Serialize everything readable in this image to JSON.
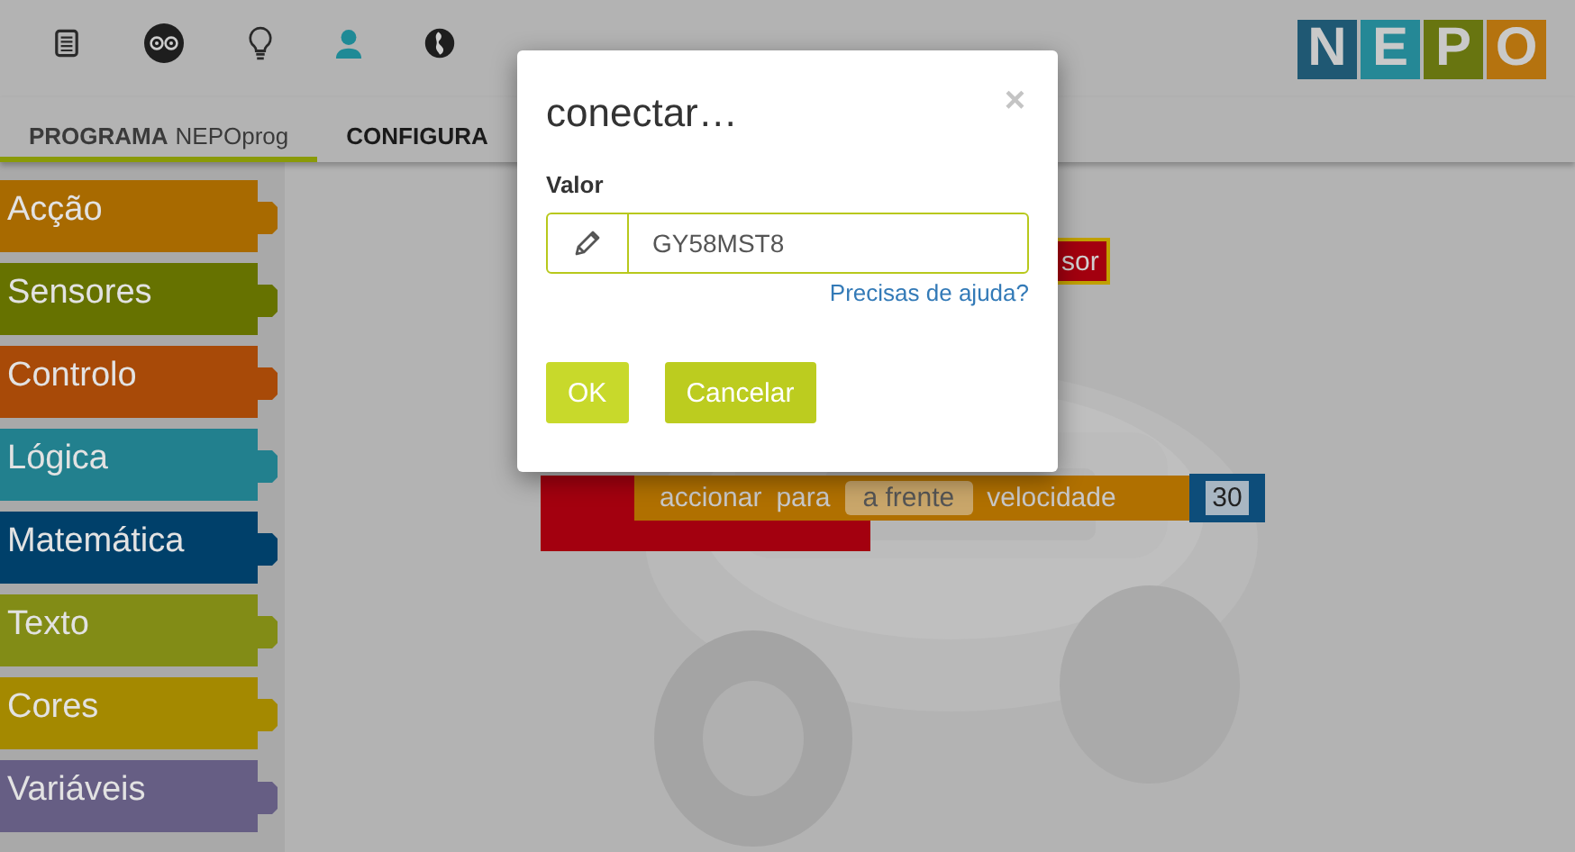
{
  "toolbar": {
    "icons": [
      {
        "kind": "document",
        "selected": false
      },
      {
        "kind": "owl",
        "selected": false
      },
      {
        "kind": "bulb",
        "selected": false
      },
      {
        "kind": "user",
        "selected": true
      },
      {
        "kind": "globe",
        "selected": false
      }
    ]
  },
  "logo": {
    "letters": [
      {
        "text": "N",
        "color": "#1f5873"
      },
      {
        "text": "E",
        "color": "#258896"
      },
      {
        "text": "P",
        "color": "#687510"
      },
      {
        "text": "O",
        "color": "#b5730f"
      }
    ]
  },
  "tabs": [
    {
      "label": "PROGRAMA",
      "sublabel": "NEPOprog",
      "selected": true
    },
    {
      "label": "CONFIGURA",
      "selected": false
    }
  ],
  "categories": [
    {
      "label": "Acção",
      "color": "#a86a00"
    },
    {
      "label": "Sensores",
      "color": "#667200"
    },
    {
      "label": "Controlo",
      "color": "#a84a08"
    },
    {
      "label": "Lógica",
      "color": "#22808e"
    },
    {
      "label": "Matemática",
      "color": "#00406a"
    },
    {
      "label": "Texto",
      "color": "#828c16"
    },
    {
      "label": "Cores",
      "color": "#a48900"
    },
    {
      "label": "Variáveis",
      "color": "#665e84"
    }
  ],
  "canvas": {
    "sensor_block": {
      "text": "sor"
    },
    "drive_block": {
      "words": [
        "accionar",
        "para"
      ],
      "dropdown": "a frente",
      "speed_label": "velocidade",
      "value": "30"
    }
  },
  "dialog": {
    "title": "conectar…",
    "close": "×",
    "field_label": "Valor",
    "value": "GY58MST8",
    "help_link": "Precisas de ajuda?",
    "buttons": [
      {
        "label": "OK",
        "kind": "ok"
      },
      {
        "label": "Cancelar",
        "kind": "cancel"
      }
    ]
  }
}
